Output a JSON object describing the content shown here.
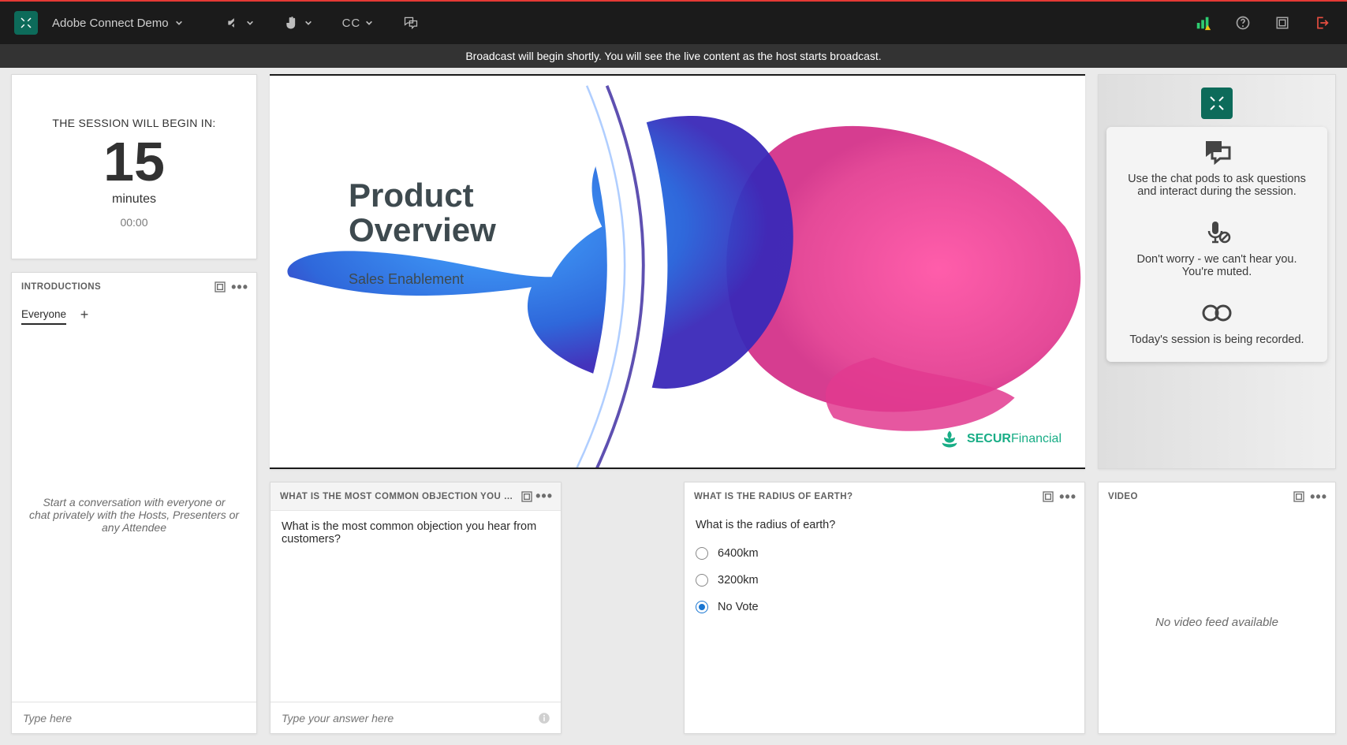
{
  "topbar": {
    "title": "Adobe Connect Demo",
    "cc_label": "CC"
  },
  "broadcast_message": "Broadcast will begin shortly. You will see the live content as the host starts broadcast.",
  "timer": {
    "label": "THE SESSION WILL BEGIN IN:",
    "value": "15",
    "unit": "minutes",
    "clock": "00:00"
  },
  "introductions": {
    "header": "INTRODUCTIONS",
    "tabs": [
      "Everyone"
    ],
    "empty_line1": "Start a conversation with everyone or",
    "empty_line2": "chat privately with the Hosts, Presenters or any Attendee",
    "placeholder": "Type here"
  },
  "presentation": {
    "title_line1": "Product",
    "title_line2": "Overview",
    "subtitle": "Sales Enablement",
    "brand_bold": "SECUR",
    "brand_rest": "Financial"
  },
  "info": {
    "chat_tip": "Use the chat pods to ask questions and interact during the session.",
    "mute_tip": "Don't worry - we can't hear you. You're muted.",
    "record_tip": "Today's session is being recorded."
  },
  "poll1": {
    "header": "WHAT IS THE MOST COMMON OBJECTION YOU HEAR FROM CUS...",
    "question": "What is the most common objection you hear from customers?",
    "placeholder": "Type your answer here"
  },
  "poll2": {
    "header": "WHAT IS THE RADIUS OF EARTH?",
    "question": "What is the radius of earth?",
    "options": [
      "6400km",
      "3200km",
      "No Vote"
    ],
    "selected_index": 2
  },
  "video": {
    "header": "VIDEO",
    "empty": "No video feed available"
  }
}
